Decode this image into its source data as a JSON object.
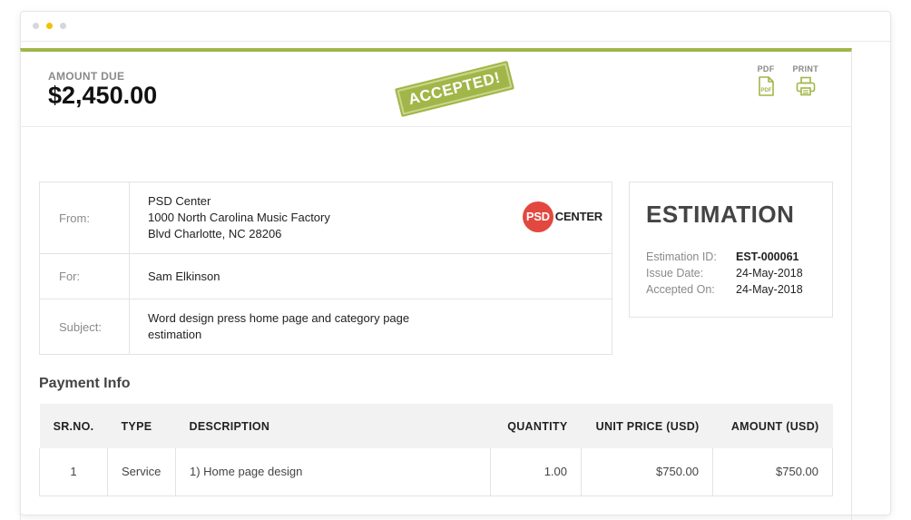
{
  "header": {
    "amount_label": "AMOUNT DUE",
    "amount_value": "$2,450.00",
    "stamp": "ACCEPTED!",
    "actions": [
      {
        "label": "PDF",
        "icon": "pdf-file-icon"
      },
      {
        "label": "PRINT",
        "icon": "printer-icon"
      }
    ]
  },
  "info": {
    "from_label": "From:",
    "from_lines": [
      "PSD Center",
      "1000 North Carolina Music Factory",
      "Blvd Charlotte, NC 28206"
    ],
    "logo_mark": "PSD",
    "logo_text": "CENTER",
    "for_label": "For:",
    "for_value": "Sam Elkinson",
    "subject_label": "Subject:",
    "subject_lines": [
      "Word design press home page and category page",
      "estimation"
    ]
  },
  "estimation": {
    "title": "ESTIMATION",
    "rows": [
      {
        "key": "Estimation ID:",
        "value": "EST-000061"
      },
      {
        "key": "Issue Date:",
        "value": "24-May-2018"
      },
      {
        "key": "Accepted On:",
        "value": "24-May-2018"
      }
    ]
  },
  "payment": {
    "title": "Payment Info",
    "columns": [
      "SR.NO.",
      "TYPE",
      "DESCRIPTION",
      "QUANTITY",
      "UNIT PRICE (USD)",
      "AMOUNT (USD)"
    ],
    "rows": [
      {
        "sr": "1",
        "type": "Service",
        "description": "1) Home page design",
        "quantity": "1.00",
        "unit_price": "$750.00",
        "amount": "$750.00"
      }
    ]
  },
  "colors": {
    "accent": "#a1b648",
    "logo_red": "#e2483f",
    "window_dot_active": "#f2c200"
  }
}
